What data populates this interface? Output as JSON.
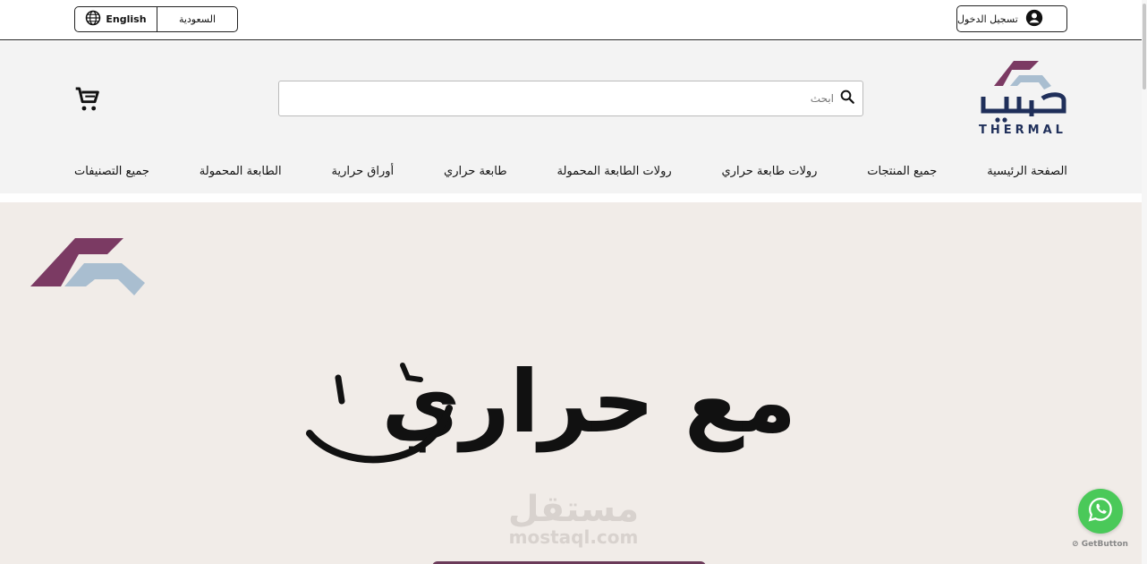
{
  "topbar": {
    "login_label": "تسجيل الدخول",
    "lang_english": "English",
    "lang_country": "السعودية"
  },
  "header": {
    "logo_text": "THERMAL",
    "search_placeholder": "ابحث",
    "cart_icon": "cart-icon"
  },
  "nav": {
    "items": [
      {
        "label": "الصفحة الرئيسية"
      },
      {
        "label": "جميع المنتجات"
      },
      {
        "label": "رولات طابعة حراري"
      },
      {
        "label": "رولات الطابعة المحمولة"
      },
      {
        "label": "طابعة حراري"
      },
      {
        "label": "أوراق حرارية"
      },
      {
        "label": "الطابعة المحمولة"
      },
      {
        "label": "جميع التصنيفات"
      }
    ]
  },
  "hero": {
    "title": "مع حراري",
    "watermark_ar": "مستقل",
    "watermark_en": "mostaql.com"
  },
  "widget": {
    "getbutton_label": "GetButton"
  },
  "colors": {
    "brand_purple": "#7b3a63",
    "brand_blue": "#a9bed0",
    "brand_navy": "#1f2f5a",
    "hero_bg": "#f1ece8",
    "whatsapp_green": "#4ac959"
  }
}
